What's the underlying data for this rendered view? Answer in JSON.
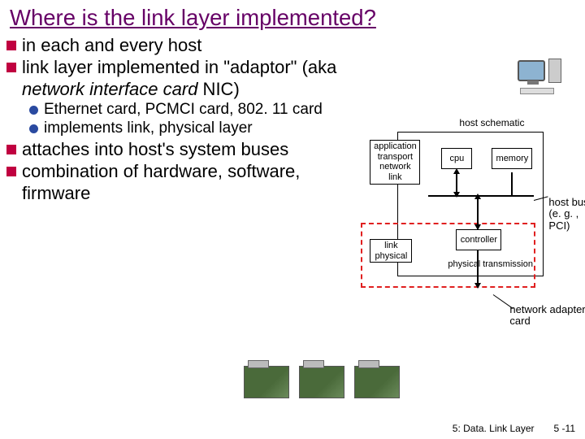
{
  "title": "Where is the link layer implemented?",
  "bullets": {
    "b1": "in each and every host",
    "b2_pre": "link layer implemented in \"adaptor\" (aka ",
    "b2_em": "network interface card",
    "b2_post": " NIC)",
    "s1": "Ethernet card, PCMCI card, 802. 11 card",
    "s2": "implements link, physical layer",
    "b3": "attaches into host's system buses",
    "b4": "combination of hardware, software, firmware"
  },
  "diagram": {
    "host_schematic": "host schematic",
    "stack_upper": [
      "application",
      "transport",
      "network",
      "link"
    ],
    "stack_lower": [
      "link",
      "physical"
    ],
    "cpu": "cpu",
    "memory": "memory",
    "controller": "controller",
    "phys_trans": "physical transmission",
    "host_bus": "host bus (e. g. , PCI)",
    "nic_label": "network adapter card"
  },
  "footer": {
    "chapter": "5: Data. Link Layer",
    "page": "5 -11"
  }
}
